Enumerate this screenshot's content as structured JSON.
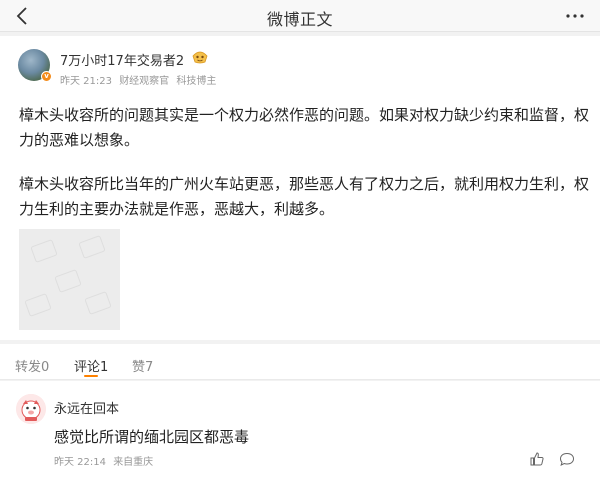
{
  "topbar": {
    "title": "微博正文"
  },
  "post": {
    "username": "7万小时17年交易者2",
    "time": "昨天 21:23",
    "source": "财经观察官",
    "tag": "科技博主",
    "paragraphs": [
      "樟木头收容所的问题其实是一个权力必然作恶的问题。如果对权力缺少约束和监督，权力的恶难以想象。",
      "樟木头收容所比当年的广州火车站更恶，那些恶人有了权力之后，就利用权力生利，权力生利的主要办法就是作恶，恶越大，利越多。"
    ]
  },
  "tabs": [
    {
      "label": "转发0"
    },
    {
      "label": "评论1"
    },
    {
      "label": "赞7"
    }
  ],
  "comment": {
    "username": "永远在回本",
    "text": "感觉比所谓的缅北园区都恶毒",
    "time": "昨天 22:14",
    "location": "来自重庆"
  },
  "colors": {
    "accent": "#ff8200",
    "badge": "#f38b1a"
  }
}
